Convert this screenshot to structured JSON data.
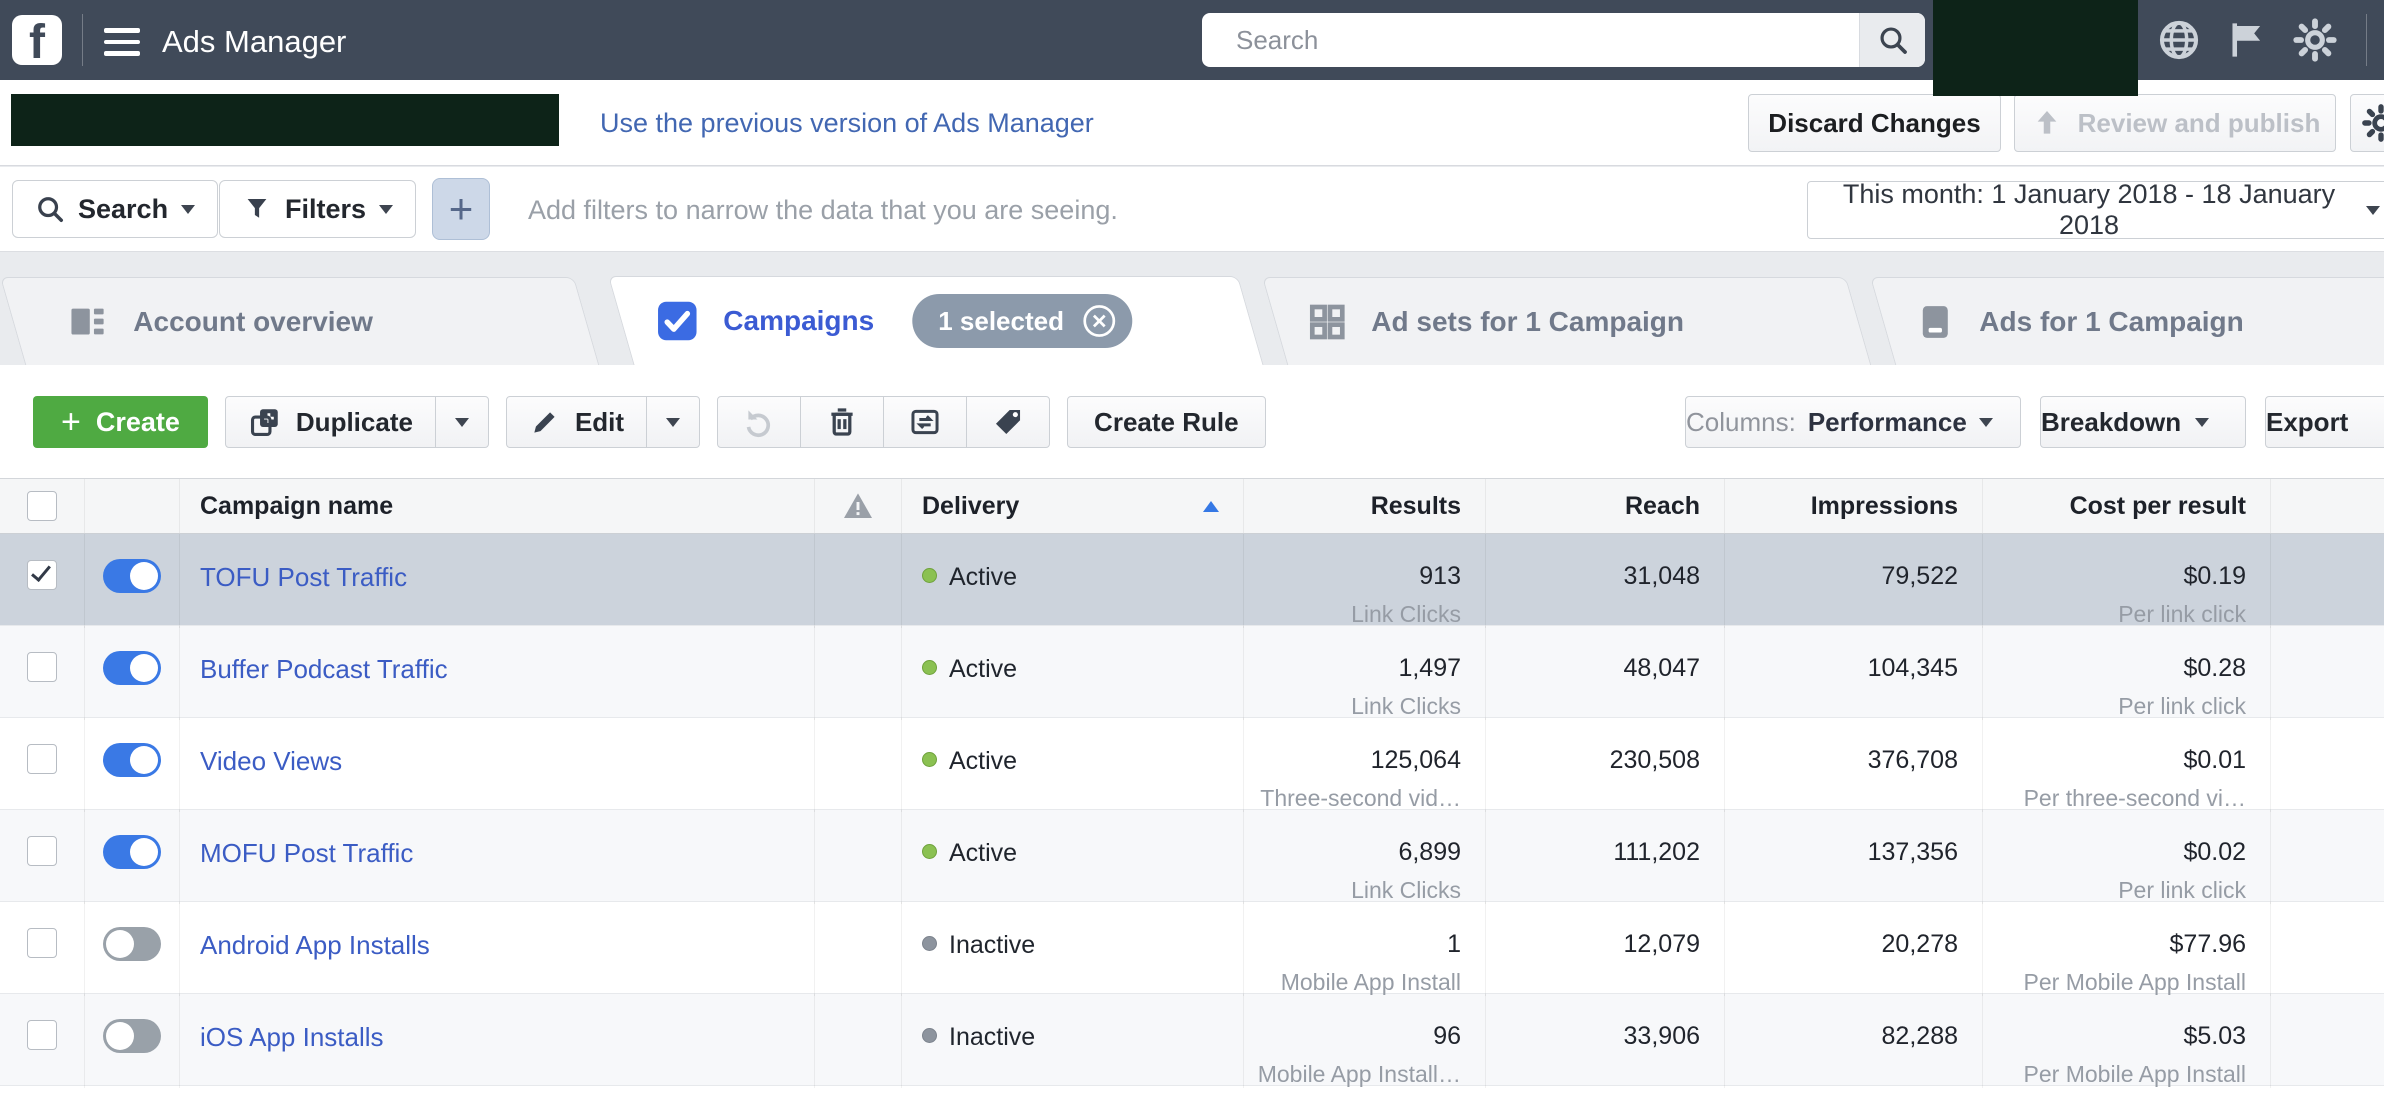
{
  "nav": {
    "title": "Ads Manager",
    "search_placeholder": "Search"
  },
  "subheader": {
    "previous_version_link": "Use the previous version of Ads Manager",
    "discard_label": "Discard Changes",
    "review_label": "Review and publish"
  },
  "filterbar": {
    "search_label": "Search",
    "filters_label": "Filters",
    "add_button": "+",
    "hint": "Add filters to narrow the data that you are seeing.",
    "date_range": "This month: 1 January 2018 - 18 January 2018"
  },
  "tabs": {
    "account_overview": "Account overview",
    "campaigns": "Campaigns",
    "selected_badge": "1 selected",
    "adsets": "Ad sets for 1 Campaign",
    "ads": "Ads for 1 Campaign"
  },
  "toolbar": {
    "create": "Create",
    "duplicate": "Duplicate",
    "edit": "Edit",
    "create_rule": "Create Rule",
    "columns_prefix": "Columns:",
    "columns_value": "Performance",
    "breakdown": "Breakdown",
    "export": "Export"
  },
  "table": {
    "headers": {
      "name": "Campaign name",
      "delivery": "Delivery",
      "results": "Results",
      "reach": "Reach",
      "impressions": "Impressions",
      "cost": "Cost per result"
    },
    "rows": [
      {
        "name": "TOFU Post Traffic",
        "selected": true,
        "toggle": "on",
        "status": "Active",
        "results": "913",
        "results_label": "Link Clicks",
        "reach": "31,048",
        "impressions": "79,522",
        "cost": "$0.19",
        "cost_label": "Per link click"
      },
      {
        "name": "Buffer Podcast Traffic",
        "selected": false,
        "toggle": "on",
        "status": "Active",
        "results": "1,497",
        "results_label": "Link Clicks",
        "reach": "48,047",
        "impressions": "104,345",
        "cost": "$0.28",
        "cost_label": "Per link click"
      },
      {
        "name": "Video Views",
        "selected": false,
        "toggle": "on",
        "status": "Active",
        "results": "125,064",
        "results_label": "Three-second vid…",
        "reach": "230,508",
        "impressions": "376,708",
        "cost": "$0.01",
        "cost_label": "Per three-second vi…"
      },
      {
        "name": "MOFU Post Traffic",
        "selected": false,
        "toggle": "on",
        "status": "Active",
        "results": "6,899",
        "results_label": "Link Clicks",
        "reach": "111,202",
        "impressions": "137,356",
        "cost": "$0.02",
        "cost_label": "Per link click"
      },
      {
        "name": "Android App Installs",
        "selected": false,
        "toggle": "off",
        "status": "Inactive",
        "results": "1",
        "results_label": "Mobile App Install",
        "reach": "12,079",
        "impressions": "20,278",
        "cost": "$77.96",
        "cost_label": "Per Mobile App Install"
      },
      {
        "name": "iOS App Installs",
        "selected": false,
        "toggle": "off",
        "status": "Inactive",
        "results": "96",
        "results_label": "Mobile App Install…",
        "reach": "33,906",
        "impressions": "82,288",
        "cost": "$5.03",
        "cost_label": "Per Mobile App Install"
      }
    ]
  },
  "icons": {
    "facebook-logo": "f",
    "menu-icon": "hamburger",
    "search-icon": "magnifier",
    "globe-icon": "globe",
    "flag-icon": "flag",
    "gear-icon": "cog",
    "upload-icon": "arrow-up",
    "filter-icon": "funnel",
    "duplicate-icon": "copy",
    "edit-icon": "pencil",
    "undo-icon": "rotate-ccw",
    "delete-icon": "trash",
    "abtest-icon": "box-arrows",
    "tag-icon": "tag",
    "warning-icon": "triangle-exclamation",
    "sort-asc-icon": "triangle-up",
    "close-circle-icon": "circle-x"
  },
  "colors": {
    "nav_bg": "#404a59",
    "accent_blue": "#3578e5",
    "link_blue": "#3b5cc4",
    "create_green": "#4faa42",
    "selected_row": "#ccd3dc",
    "active_dot": "#8bc152",
    "redaction": "#0d2318"
  }
}
